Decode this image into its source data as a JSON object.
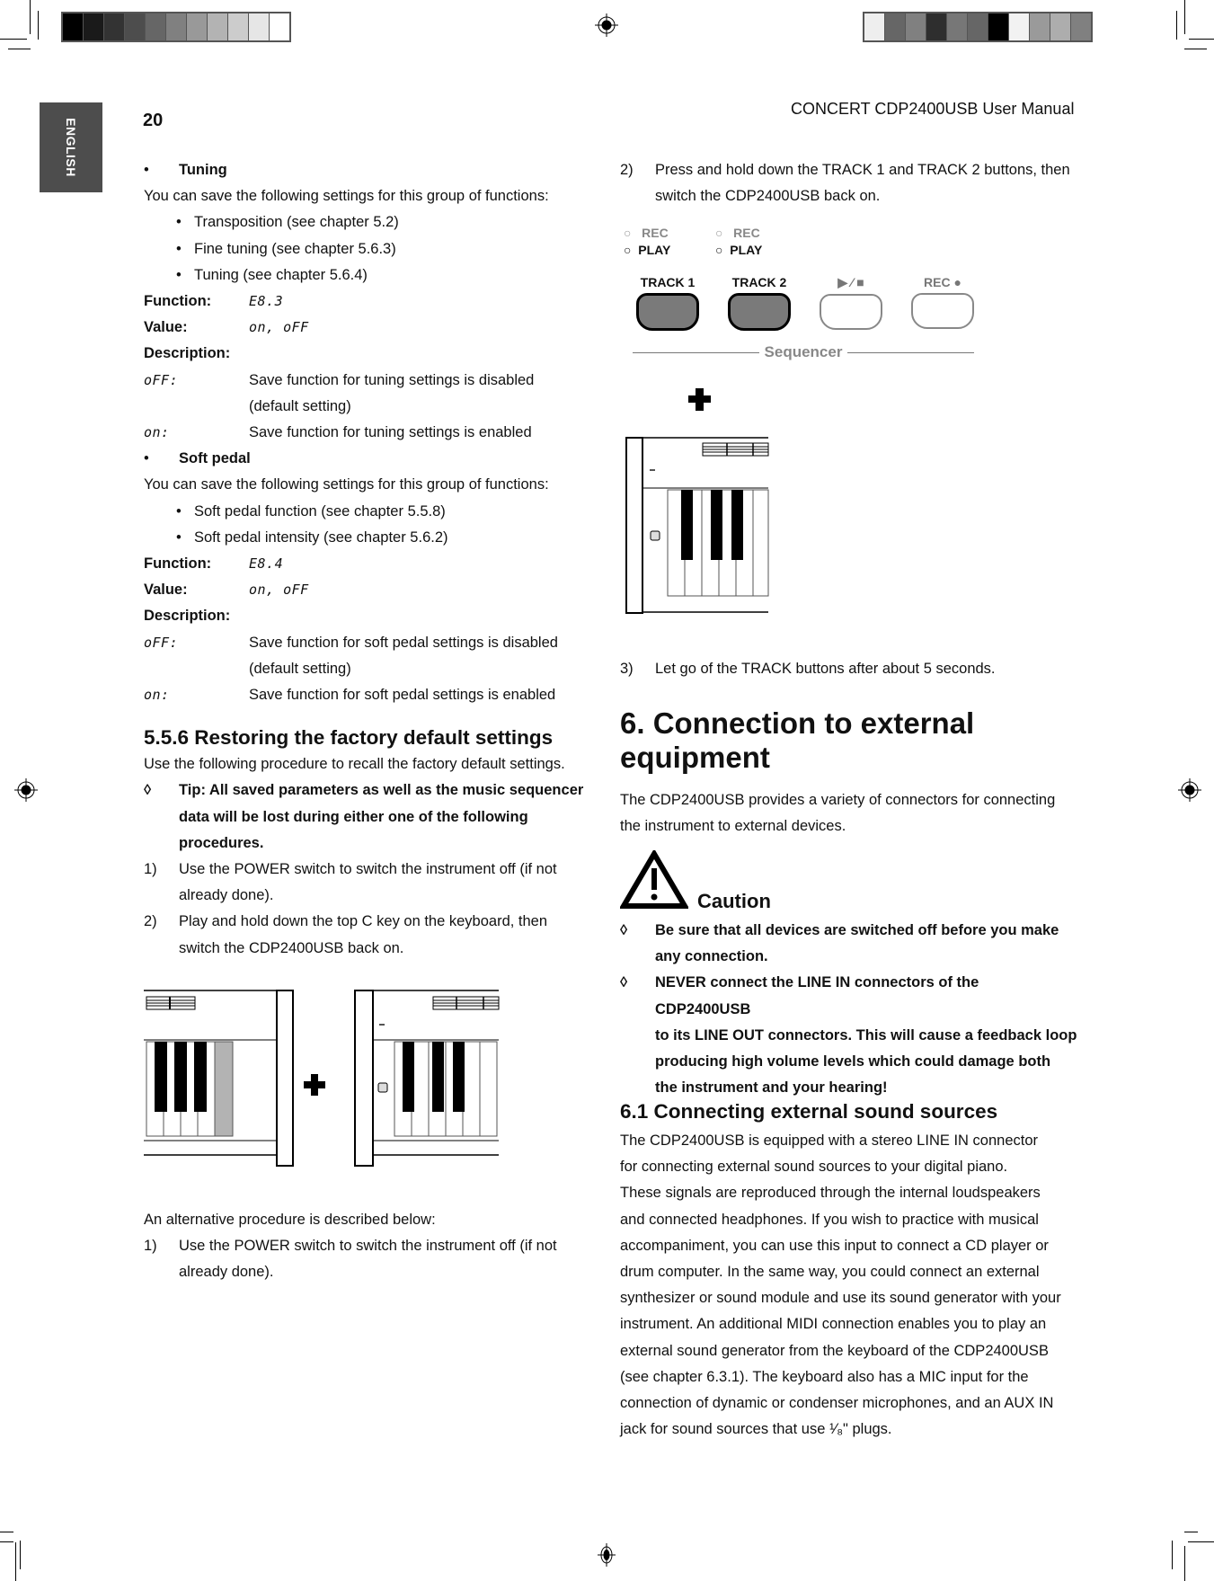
{
  "header": {
    "language_tab": "ENGLISH",
    "page_number": "20",
    "running_title": "CONCERT CDP2400USB User Manual"
  },
  "print_marks": {
    "left_color_bar": [
      "#000000",
      "#1a1a1a",
      "#333333",
      "#4d4d4d",
      "#666666",
      "#808080",
      "#999999",
      "#b3b3b3",
      "#cccccc",
      "#e6e6e6",
      "#ffffff"
    ],
    "right_color_bar": [
      "#eeeeee",
      "#666666",
      "#808080",
      "#2e2e2e",
      "#777777",
      "#666666",
      "#000000",
      "#f2f2f2",
      "#9a9a9a",
      "#adadad",
      "#808080"
    ]
  },
  "left_column": {
    "tuning": {
      "title": "Tuning",
      "intro": "You can save the following settings for this group of functions:",
      "items": [
        "Transposition (see chapter 5.2)",
        "Fine tuning (see chapter 5.6.3)",
        "Tuning (see chapter 5.6.4)"
      ],
      "function_label": "Function:",
      "function_value": "E8.3",
      "value_label": "Value:",
      "value_value": "on, oFF",
      "description_label": "Description:",
      "off_label": "oFF:",
      "off_text_1": "Save function for tuning settings is disabled",
      "off_text_2": "(default setting)",
      "on_label": "on:",
      "on_text": "Save function for tuning settings is enabled"
    },
    "soft_pedal": {
      "title": "Soft pedal",
      "intro": "You can save the following settings for this group of functions:",
      "items": [
        "Soft pedal function (see chapter 5.5.8)",
        "Soft pedal intensity (see chapter 5.6.2)"
      ],
      "function_label": "Function:",
      "function_value": "E8.4",
      "value_label": "Value:",
      "value_value": "on, oFF",
      "description_label": "Description:",
      "off_label": "oFF:",
      "off_text_1": "Save function for soft pedal settings is disabled",
      "off_text_2": "(default setting)",
      "on_label": "on:",
      "on_text": "Save function for soft pedal settings is enabled"
    },
    "section_556": {
      "heading": "5.5.6  Restoring the factory default settings",
      "intro": "Use the following procedure to recall the factory default settings.",
      "tip_symbol": "◊",
      "tip_lines": [
        "Tip: All saved parameters as well as the music sequencer",
        "data will be lost during either one of the following",
        "procedures."
      ],
      "steps": [
        {
          "n": "1)",
          "lines": [
            "Use the POWER switch to switch the instrument off (if not",
            "already done)."
          ]
        },
        {
          "n": "2)",
          "lines": [
            "Play and hold down the top C key on the keyboard, then",
            "switch the CDP2400USB back on."
          ]
        }
      ],
      "plus_symbol": "+",
      "alt_intro": "An alternative procedure is described below:",
      "alt_steps": [
        {
          "n": "1)",
          "lines": [
            "Use the POWER switch to switch the instrument off (if not",
            "already done)."
          ]
        }
      ]
    }
  },
  "right_column": {
    "step2": {
      "n": "2)",
      "lines": [
        "Press and hold down the TRACK 1 and TRACK 2 buttons, then",
        "switch the CDP2400USB back on."
      ]
    },
    "sequencer_panel": {
      "rec_label": "REC",
      "play_label": "PLAY",
      "buttons": [
        {
          "label": "TRACK 1",
          "pressed": true
        },
        {
          "label": "TRACK 2",
          "pressed": true
        },
        {
          "label": "▶ ⁄ ■",
          "pressed": false
        },
        {
          "label": "REC ●",
          "pressed": false
        }
      ],
      "group_label": "Sequencer"
    },
    "plus_symbol": "+",
    "step3": {
      "n": "3)",
      "text": "Let go of the TRACK buttons after about 5 seconds."
    },
    "chapter6": {
      "heading_line1": "6.  Connection to external",
      "heading_line2": "equipment",
      "intro_lines": [
        "The CDP2400USB provides a variety of connectors for connecting",
        "the instrument to external devices."
      ]
    },
    "caution": {
      "title": "Caution",
      "symbol": "◊",
      "items": [
        [
          "Be sure that all devices are switched off before you make",
          "any connection."
        ],
        [
          "NEVER connect the LINE IN connectors of the CDP2400USB",
          "to its LINE OUT connectors. This will cause a feedback loop",
          "producing high volume levels which could damage both",
          "the instrument and your hearing!"
        ]
      ]
    },
    "section_61": {
      "heading": "6.1  Connecting external sound sources",
      "lines": [
        "The CDP2400USB is equipped with a stereo LINE IN connector",
        "for connecting external sound sources to your digital piano.",
        "These signals are reproduced through the internal loudspeakers",
        "and connected headphones. If you wish to practice with musical",
        "accompaniment, you can use this input to connect a CD player or",
        "drum computer. In the same way, you could connect an external",
        "synthesizer or sound module and use its sound generator with your",
        "instrument. An additional MIDI connection enables you to play an",
        "external sound generator from the keyboard of the CDP2400USB",
        "(see chapter 6.3.1). The keyboard also has a MIC input for the",
        "connection of dynamic or condenser microphones, and an AUX IN",
        "jack for sound sources that use ¹⁄₈\" plugs."
      ]
    }
  }
}
